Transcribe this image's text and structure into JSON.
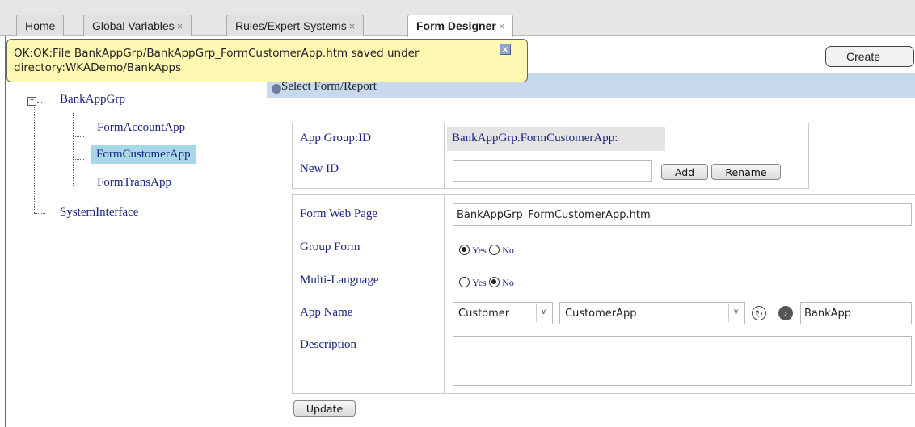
{
  "tabs": [
    {
      "label": "Home",
      "closable": false
    },
    {
      "label": "Global Variables",
      "closable": true
    },
    {
      "label": "Rules/Expert Systems",
      "closable": true
    },
    {
      "label": "Form Designer",
      "closable": true,
      "active": true
    }
  ],
  "tab_close_glyph": "×",
  "notification": {
    "text": "OK:OK:File BankAppGrp/BankAppGrp_FormCustomerApp.htm saved under directory:WKADemo/BankApps",
    "close_label": "x"
  },
  "toolbar": {
    "create_label": "Create"
  },
  "tree": {
    "root": "BankAppGrp",
    "children": [
      "FormAccountApp",
      "FormCustomerApp",
      "FormTransApp"
    ],
    "selected": "FormCustomerApp",
    "sibling": "SystemInterface",
    "toggle_glyph": "−"
  },
  "section": {
    "title": "Select Form/Report"
  },
  "id_panel": {
    "app_group_label": "App Group:ID",
    "app_group_value": "BankAppGrp.FormCustomerApp:",
    "new_id_label": "New ID",
    "new_id_value": "",
    "add_label": "Add",
    "rename_label": "Rename"
  },
  "form_panel": {
    "web_page_label": "Form Web Page",
    "web_page_value": "BankAppGrp_FormCustomerApp.htm",
    "group_form_label": "Group Form",
    "group_form_yes": "Yes",
    "group_form_no": "No",
    "group_form_selected": "Yes",
    "multi_lang_label": "Multi-Language",
    "multi_lang_yes": "Yes",
    "multi_lang_no": "No",
    "multi_lang_selected": "No",
    "app_name_label": "App Name",
    "app_select_1": "Customer",
    "app_select_2": "CustomerApp",
    "app_name_value": "BankApp",
    "description_label": "Description",
    "description_value": ""
  },
  "update_label": "Update",
  "icons": {
    "refresh": "refresh-icon",
    "next": "arrow-right-icon"
  },
  "colors": {
    "selection": "#a8d8e8",
    "notification_bg": "#fff8b3",
    "section_header_bg": "#c9d9ed",
    "label_text": "#1a237e"
  }
}
